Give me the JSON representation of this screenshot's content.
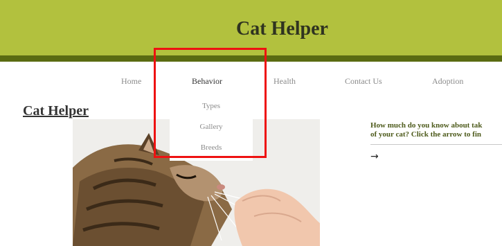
{
  "header": {
    "title": "Cat Helper"
  },
  "nav": {
    "items": [
      {
        "label": "Home"
      },
      {
        "label": "Behavior"
      },
      {
        "label": "Health"
      },
      {
        "label": "Contact Us"
      },
      {
        "label": "Adoption"
      }
    ],
    "dropdown": [
      {
        "label": "Types"
      },
      {
        "label": "Gallery"
      },
      {
        "label": "Breeds"
      }
    ]
  },
  "main": {
    "title": "Cat Helper",
    "question_line1": "How much do you know about tak",
    "question_line2": "of your cat? Click the arrow to fin",
    "arrow_icon": "→"
  },
  "colors": {
    "header_bg": "#b2c13e",
    "header_band": "#5a6b12",
    "highlight": "#ee1111"
  }
}
